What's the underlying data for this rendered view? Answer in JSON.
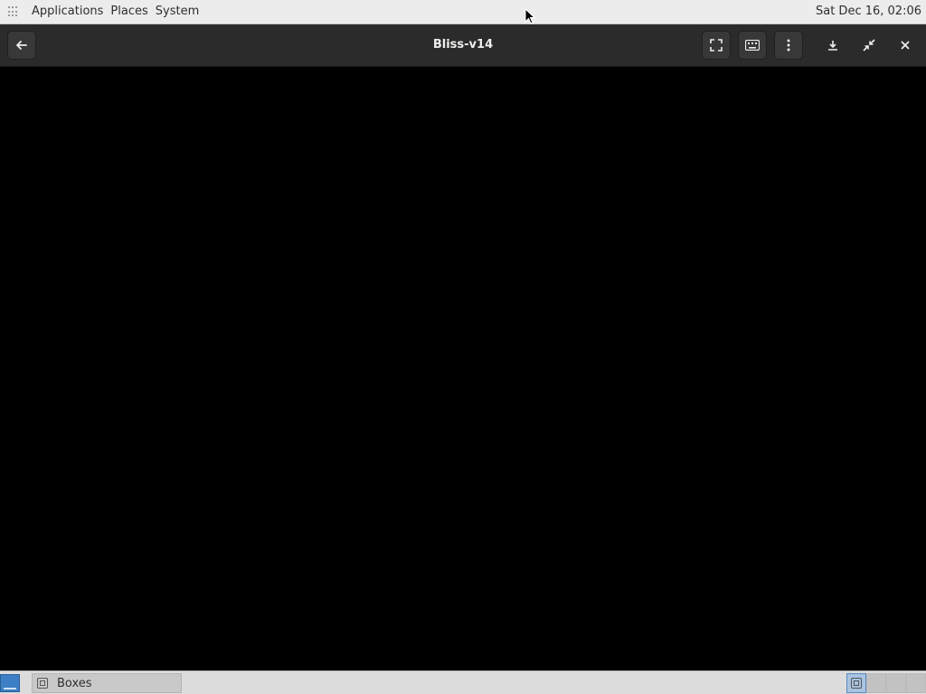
{
  "top_panel": {
    "menus": [
      "Applications",
      "Places",
      "System"
    ],
    "clock": "Sat Dec 16, 02:06"
  },
  "window": {
    "title": "Bliss-v14",
    "buttons": {
      "back": "back-arrow-icon",
      "fullscreen": "fullscreen-icon",
      "keyboard": "keyboard-icon",
      "menu": "vertical-ellipsis-icon",
      "minimize": "minimize-icon",
      "unmaximize": "unmaximize-icon",
      "close": "close-icon"
    }
  },
  "taskbar": {
    "task_label": "Boxes",
    "workspaces": 4,
    "active_workspace": 1
  },
  "colors": {
    "headerbar": "#2b2b2b",
    "top_panel": "#ececec",
    "display": "#000000",
    "accent": "#3c7fc4"
  }
}
